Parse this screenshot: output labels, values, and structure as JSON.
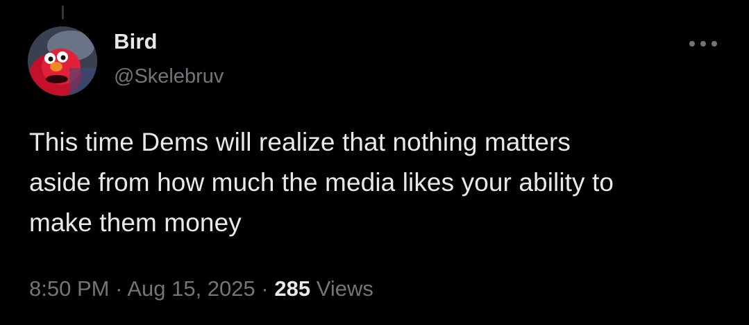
{
  "author": {
    "display_name": "Bird",
    "handle": "@Skelebruv",
    "avatar_icon": "red-puppet-avatar"
  },
  "more_icon": "more-horizontal-icon",
  "tweet": {
    "lines": [
      "This time Dems will realize that nothing matters",
      "aside from how much the media likes your ability to",
      "make them money"
    ]
  },
  "meta": {
    "time": "8:50 PM",
    "separator": "·",
    "date": "Aug 15, 2025",
    "views_count": "285",
    "views_label": "Views"
  },
  "colors": {
    "background": "#000000",
    "primary_text": "#e7e9ea",
    "secondary_text": "#71767b"
  }
}
